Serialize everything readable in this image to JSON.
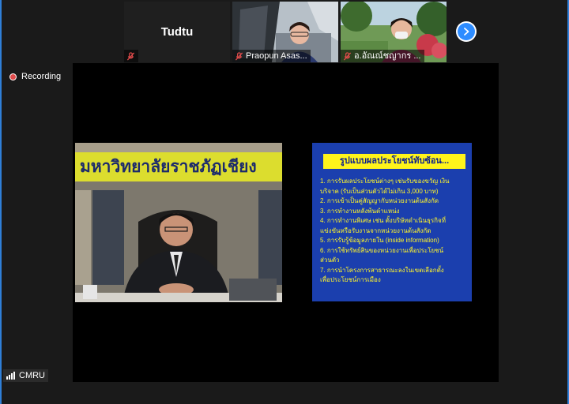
{
  "participants": [
    {
      "display": "Tudtu",
      "name": ""
    },
    {
      "display": "",
      "name": "Praopun Asas..."
    },
    {
      "display": "",
      "name": "อ.อัณณ์ชญากร ..."
    }
  ],
  "recording_label": "Recording",
  "host_label": "CMRU",
  "banner_text": "มหาวิทยาลัยราชภัฏเชียง",
  "slide": {
    "title": "รูปแบบผลประโยชน์ทับซ้อน...",
    "items": [
      "1. การรับผลประโยชน์ต่างๆ เช่นรับของขวัญ เงิน",
      "    บริจาค (รับเป็นส่วนตัวได้ไม่เกิน 3,000 บาท)",
      "2. การเข้าเป็นคู่สัญญากับหน่วยงานต้นสังกัด",
      "3. การทำงานหลังพ้นตำแหน่ง",
      "4. การทำงานพิเศษ เช่น ตั้งบริษัทดำเนินธุรกิจที่",
      "    แข่งขันหรือรับงานจากหน่วยงานต้นสังกัด",
      "5. การรับรู้ข้อมูลภายใน (inside information)",
      "6. การใช้ทรัพย์สินของหน่วยงานเพื่อประโยชน์",
      "    ส่วนตัว",
      "7. การนำโครงการสาธารณะลงในเขตเลือกตั้ง",
      "    เพื่อประโยชน์การเมือง"
    ]
  },
  "colors": {
    "accent": "#2d8cff",
    "slide_bg": "#1b3fae",
    "slide_text": "#fff52a"
  }
}
